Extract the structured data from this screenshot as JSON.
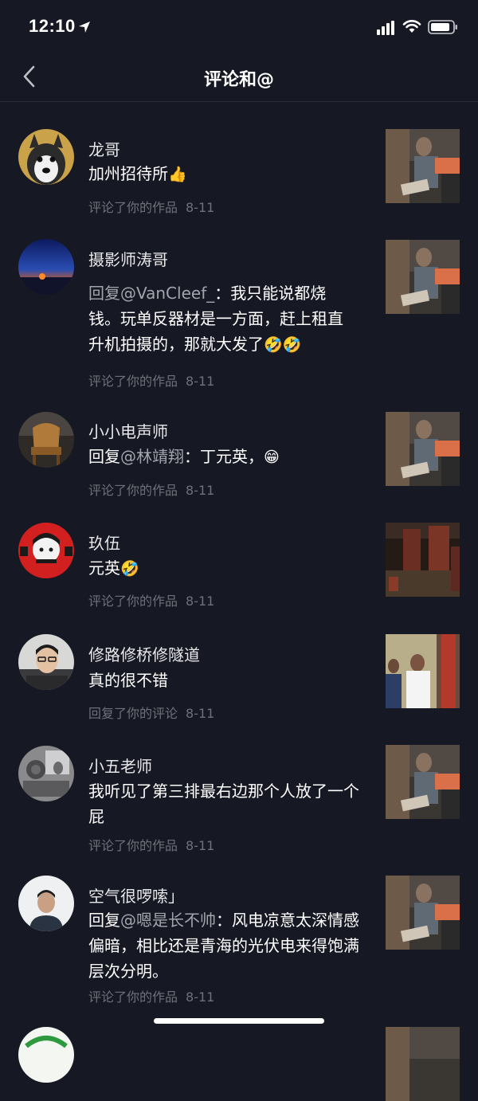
{
  "status_bar": {
    "time": "12:10"
  },
  "header": {
    "title": "评论和@"
  },
  "comments": [
    {
      "name": "龙哥",
      "text": "加州招待所",
      "emoji": "👍",
      "action": "评论了你的作品",
      "date": "8-11"
    },
    {
      "name": "摄影师涛哥",
      "mention": "回复@VanCleef_",
      "text": "：我只能说都烧钱。玩单反器材是一方面，赶上租直升机拍摄的，那就大发了",
      "emoji": "🤣🤣",
      "action": "评论了你的作品",
      "date": "8-11"
    },
    {
      "name": "小小电声师",
      "prefix": "回复",
      "mention": "@林靖翔",
      "text": "：丁元英，",
      "emoji": "😁",
      "action": "评论了你的作品",
      "date": "8-11"
    },
    {
      "name": "玖伍",
      "text": "元英",
      "emoji": "🤣",
      "action": "评论了你的作品",
      "date": "8-11"
    },
    {
      "name": "修路修桥修隧道",
      "text": "真的很不错",
      "action": "回复了你的评论",
      "date": "8-11"
    },
    {
      "name": "小五老师",
      "text": "我听见了第三排最右边那个人放了一个屁",
      "action": "评论了你的作品",
      "date": "8-11"
    },
    {
      "name": "空气很啰嗦」",
      "prefix": "回复",
      "mention": "@嗯是长不帅",
      "text": "：风电凉意太深情感偏暗，相比还是青海的光伏电来得饱满层次分明。",
      "action": "评论了你的作品",
      "date": "8-11"
    }
  ]
}
